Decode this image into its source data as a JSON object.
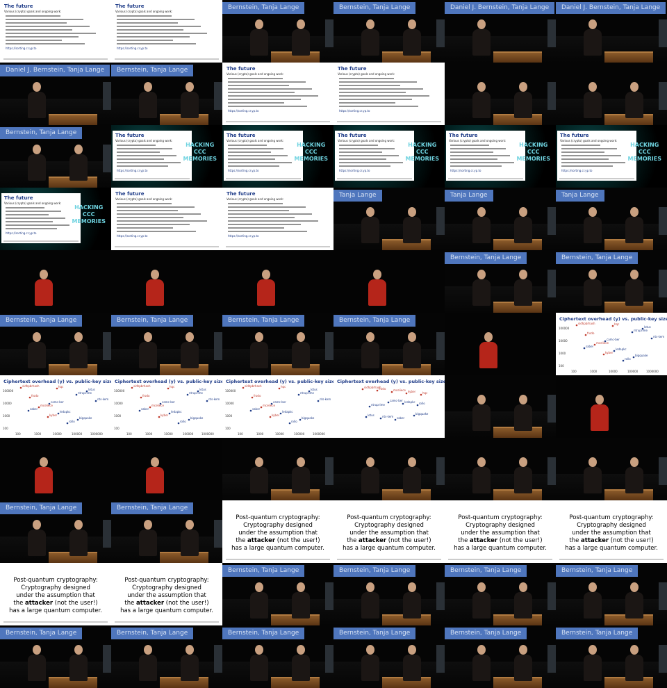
{
  "names": {
    "both": "Daniel J. Bernstein, Tanja Lange",
    "bernstein_lange": "Bernstein, Tanja Lange",
    "tanja": "Tanja Lange"
  },
  "slide_future": {
    "title": "The future",
    "intro": "Various (crypto) goals and ongoing work:",
    "site": "https://sorting.cr.yp.to"
  },
  "slide_pq": {
    "l1": "Post-quantum cryptography:",
    "l2": "Cryptography designed",
    "l3": "under the assumption that",
    "l4a": "the ",
    "l4b": "attacker",
    "l4c": " (not the user!)",
    "l5": "has a large quantum computer."
  },
  "chart": {
    "title": "Ciphertext overhead (y) vs. public-key size (x)"
  },
  "chart_data": {
    "type": "scatter",
    "title": "Ciphertext overhead (y) vs. public-key size (x)",
    "x_ticks": [
      "100",
      "1000",
      "10000",
      "100000",
      "1000000"
    ],
    "y_ticks": [
      "100",
      "1000",
      "10000",
      "100000"
    ],
    "log_x": true,
    "log_y": true,
    "labels": [
      "sidhpbrhash",
      "camc-ber",
      "bigquake",
      "frodo",
      "ledapkc",
      "lotus",
      "mceliece",
      "rollo",
      "nts-kem",
      "kyber",
      "ntruprime",
      "saber",
      "hqc"
    ]
  },
  "netlogo": "HACKING\nCCC\nMEMORIES",
  "tiles": [
    "slide-future-small",
    "slide-future-small",
    "namebar-bernstein",
    "namebar-bernstein",
    "namebar-both",
    "namebar-both",
    "namebar-both",
    "namebar-bernstein",
    "slide-future",
    "slide-future",
    "stage",
    "stage",
    "namebar-bernstein",
    "slide-net",
    "slide-net",
    "slide-net",
    "slide-net",
    "slide-net",
    "slide-net-small",
    "slide-future",
    "slide-future",
    "namebar-tanja",
    "namebar-tanja",
    "namebar-tanja",
    "red",
    "red",
    "red",
    "red",
    "namebar-bernstein",
    "namebar-bernstein",
    "namebar-bernstein",
    "namebar-bernstein",
    "namebar-bernstein",
    "namebar-bernstein",
    "red",
    "chart",
    "chart",
    "chart",
    "chart",
    "chart-zoom",
    "stage",
    "red",
    "red",
    "red",
    "stage",
    "stage",
    "stage",
    "stage",
    "namebar-bernstein",
    "namebar-bernstein",
    "pq",
    "pq",
    "pq",
    "pq",
    "pq",
    "pq",
    "namebar-bernstein",
    "namebar-bernstein",
    "namebar-bernstein",
    "namebar-bernstein",
    "namebar-bernstein",
    "namebar-bernstein",
    "namebar-bernstein",
    "namebar-bernstein",
    "namebar-bernstein",
    "namebar-bernstein"
  ]
}
